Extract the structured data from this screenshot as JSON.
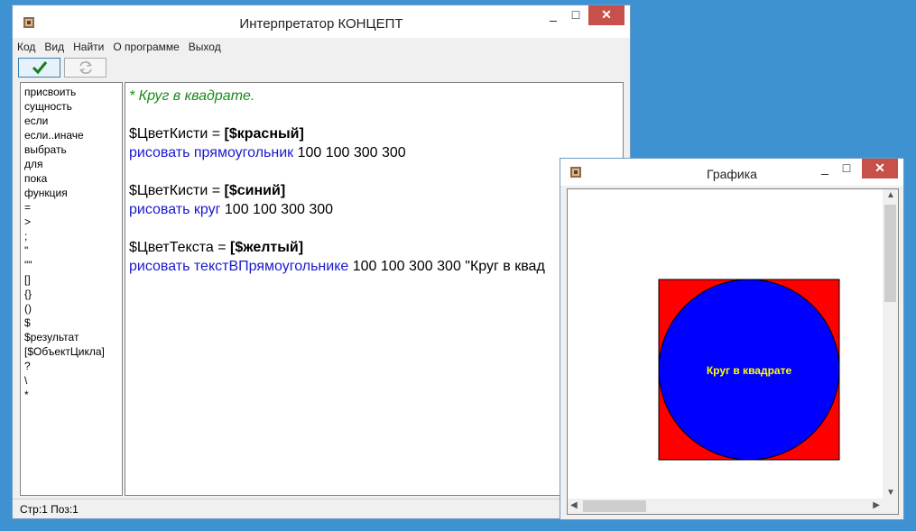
{
  "main_window": {
    "title": "Интерпретатор КОНЦЕПТ",
    "menu": [
      "Код",
      "Вид",
      "Найти",
      "О программе",
      "Выход"
    ],
    "toolbar": {
      "run_icon": "checkmark-icon",
      "refresh_icon": "refresh-icon"
    },
    "keywords": [
      "присвоить",
      "сущность",
      "если",
      "если..иначе",
      "выбрать",
      "для",
      "пока",
      "функция",
      "=",
      ">",
      ";",
      "\"",
      "\"\"",
      "[]",
      "{}",
      "()",
      "$",
      "$результат",
      "[$ОбъектЦикла]",
      "?",
      "\\",
      "*"
    ],
    "code": {
      "comment": "* Круг в квадрате.",
      "l1_var": "$ЦветКисти = ",
      "l1_val": "[$красный]",
      "l2_kw": "рисовать прямоугольник",
      "l2_args": " 100 100 300 300",
      "l3_var": "$ЦветКисти = ",
      "l3_val": "[$синий]",
      "l4_kw": "рисовать круг",
      "l4_args": " 100 100 300 300",
      "l5_var": "$ЦветТекста = ",
      "l5_val": "[$желтый]",
      "l6_kw": "рисовать текстВПрямоугольнике",
      "l6_args": " 100 100 300 300 \"Круг в квад"
    },
    "status": "Стр:1 Поз:1"
  },
  "graphics_window": {
    "title": "Графика",
    "caption": "Круг в квадрате",
    "colors": {
      "square": "#ff0000",
      "circle": "#0000ff",
      "text": "#ffff00"
    }
  },
  "window_controls": {
    "minimize": "_",
    "maximize": "□",
    "close": "✕"
  }
}
